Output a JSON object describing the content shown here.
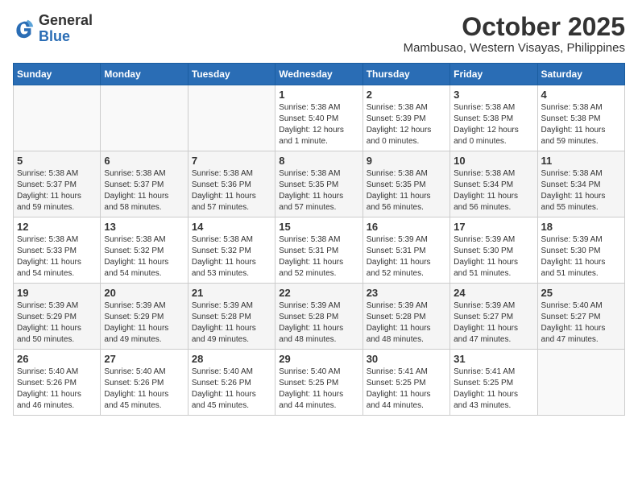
{
  "logo": {
    "general": "General",
    "blue": "Blue"
  },
  "header": {
    "month": "October 2025",
    "location": "Mambusao, Western Visayas, Philippines"
  },
  "weekdays": [
    "Sunday",
    "Monday",
    "Tuesday",
    "Wednesday",
    "Thursday",
    "Friday",
    "Saturday"
  ],
  "weeks": [
    [
      {
        "day": "",
        "info": ""
      },
      {
        "day": "",
        "info": ""
      },
      {
        "day": "",
        "info": ""
      },
      {
        "day": "1",
        "info": "Sunrise: 5:38 AM\nSunset: 5:40 PM\nDaylight: 12 hours\nand 1 minute."
      },
      {
        "day": "2",
        "info": "Sunrise: 5:38 AM\nSunset: 5:39 PM\nDaylight: 12 hours\nand 0 minutes."
      },
      {
        "day": "3",
        "info": "Sunrise: 5:38 AM\nSunset: 5:38 PM\nDaylight: 12 hours\nand 0 minutes."
      },
      {
        "day": "4",
        "info": "Sunrise: 5:38 AM\nSunset: 5:38 PM\nDaylight: 11 hours\nand 59 minutes."
      }
    ],
    [
      {
        "day": "5",
        "info": "Sunrise: 5:38 AM\nSunset: 5:37 PM\nDaylight: 11 hours\nand 59 minutes."
      },
      {
        "day": "6",
        "info": "Sunrise: 5:38 AM\nSunset: 5:37 PM\nDaylight: 11 hours\nand 58 minutes."
      },
      {
        "day": "7",
        "info": "Sunrise: 5:38 AM\nSunset: 5:36 PM\nDaylight: 11 hours\nand 57 minutes."
      },
      {
        "day": "8",
        "info": "Sunrise: 5:38 AM\nSunset: 5:35 PM\nDaylight: 11 hours\nand 57 minutes."
      },
      {
        "day": "9",
        "info": "Sunrise: 5:38 AM\nSunset: 5:35 PM\nDaylight: 11 hours\nand 56 minutes."
      },
      {
        "day": "10",
        "info": "Sunrise: 5:38 AM\nSunset: 5:34 PM\nDaylight: 11 hours\nand 56 minutes."
      },
      {
        "day": "11",
        "info": "Sunrise: 5:38 AM\nSunset: 5:34 PM\nDaylight: 11 hours\nand 55 minutes."
      }
    ],
    [
      {
        "day": "12",
        "info": "Sunrise: 5:38 AM\nSunset: 5:33 PM\nDaylight: 11 hours\nand 54 minutes."
      },
      {
        "day": "13",
        "info": "Sunrise: 5:38 AM\nSunset: 5:32 PM\nDaylight: 11 hours\nand 54 minutes."
      },
      {
        "day": "14",
        "info": "Sunrise: 5:38 AM\nSunset: 5:32 PM\nDaylight: 11 hours\nand 53 minutes."
      },
      {
        "day": "15",
        "info": "Sunrise: 5:38 AM\nSunset: 5:31 PM\nDaylight: 11 hours\nand 52 minutes."
      },
      {
        "day": "16",
        "info": "Sunrise: 5:39 AM\nSunset: 5:31 PM\nDaylight: 11 hours\nand 52 minutes."
      },
      {
        "day": "17",
        "info": "Sunrise: 5:39 AM\nSunset: 5:30 PM\nDaylight: 11 hours\nand 51 minutes."
      },
      {
        "day": "18",
        "info": "Sunrise: 5:39 AM\nSunset: 5:30 PM\nDaylight: 11 hours\nand 51 minutes."
      }
    ],
    [
      {
        "day": "19",
        "info": "Sunrise: 5:39 AM\nSunset: 5:29 PM\nDaylight: 11 hours\nand 50 minutes."
      },
      {
        "day": "20",
        "info": "Sunrise: 5:39 AM\nSunset: 5:29 PM\nDaylight: 11 hours\nand 49 minutes."
      },
      {
        "day": "21",
        "info": "Sunrise: 5:39 AM\nSunset: 5:28 PM\nDaylight: 11 hours\nand 49 minutes."
      },
      {
        "day": "22",
        "info": "Sunrise: 5:39 AM\nSunset: 5:28 PM\nDaylight: 11 hours\nand 48 minutes."
      },
      {
        "day": "23",
        "info": "Sunrise: 5:39 AM\nSunset: 5:28 PM\nDaylight: 11 hours\nand 48 minutes."
      },
      {
        "day": "24",
        "info": "Sunrise: 5:39 AM\nSunset: 5:27 PM\nDaylight: 11 hours\nand 47 minutes."
      },
      {
        "day": "25",
        "info": "Sunrise: 5:40 AM\nSunset: 5:27 PM\nDaylight: 11 hours\nand 47 minutes."
      }
    ],
    [
      {
        "day": "26",
        "info": "Sunrise: 5:40 AM\nSunset: 5:26 PM\nDaylight: 11 hours\nand 46 minutes."
      },
      {
        "day": "27",
        "info": "Sunrise: 5:40 AM\nSunset: 5:26 PM\nDaylight: 11 hours\nand 45 minutes."
      },
      {
        "day": "28",
        "info": "Sunrise: 5:40 AM\nSunset: 5:26 PM\nDaylight: 11 hours\nand 45 minutes."
      },
      {
        "day": "29",
        "info": "Sunrise: 5:40 AM\nSunset: 5:25 PM\nDaylight: 11 hours\nand 44 minutes."
      },
      {
        "day": "30",
        "info": "Sunrise: 5:41 AM\nSunset: 5:25 PM\nDaylight: 11 hours\nand 44 minutes."
      },
      {
        "day": "31",
        "info": "Sunrise: 5:41 AM\nSunset: 5:25 PM\nDaylight: 11 hours\nand 43 minutes."
      },
      {
        "day": "",
        "info": ""
      }
    ]
  ]
}
